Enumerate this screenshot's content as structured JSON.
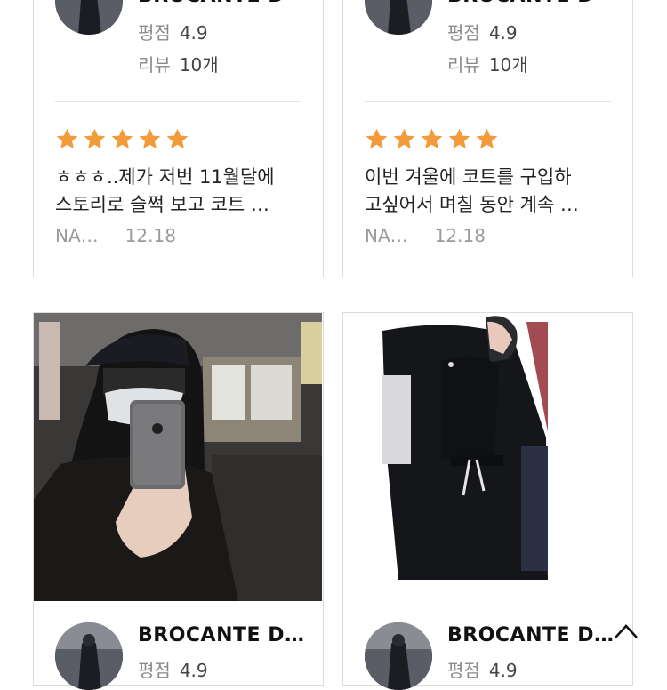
{
  "cards": [
    {
      "store_name": "BROCANTE D",
      "rating_label": "평점",
      "rating_value": "4.9",
      "review_label": "리뷰",
      "review_count": "10개",
      "stars": 5,
      "review_line1": "ㅎㅎㅎ..제가 저번 11월달에",
      "review_line2": "스토리로 슬쩍 보고 코트 …",
      "author": "NA…",
      "date": "12.18"
    },
    {
      "store_name": "BROCANTE D",
      "rating_label": "평점",
      "rating_value": "4.9",
      "review_label": "리뷰",
      "review_count": "10개",
      "stars": 5,
      "review_line1": "이번 겨울에 코트를 구입하",
      "review_line2": "고싶어서 며칠 동안 계속 …",
      "author": "NA…",
      "date": "12.18"
    },
    {
      "store_name": "BROCANTE D…",
      "rating_label": "평점",
      "rating_value": "4.9"
    },
    {
      "store_name": "BROCANTE D…",
      "rating_label": "평점",
      "rating_value": "4.9"
    }
  ],
  "colors": {
    "star": "#f39a3a",
    "card_border": "#dcdcdc",
    "muted_text": "#8a8a8a"
  },
  "icons": {
    "star": "star-icon",
    "scroll_top": "chevron-up-icon"
  }
}
